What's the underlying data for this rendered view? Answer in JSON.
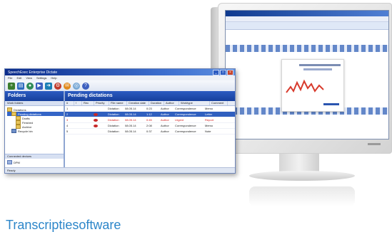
{
  "caption": "Transcriptiesoftware",
  "window": {
    "title": "SpeechExec Enterprise Dictate",
    "menu": [
      "File",
      "Edit",
      "View",
      "Settings",
      "Help"
    ],
    "toolbar": [
      {
        "icon": "new-icon",
        "color": "#3b7d2f"
      },
      {
        "icon": "open-icon",
        "color": "#2d6bbf"
      },
      {
        "icon": "record-icon",
        "color": "#2e8b57"
      },
      {
        "icon": "play-icon",
        "color": "#3a5fbf"
      },
      {
        "icon": "send-icon",
        "color": "#1a7fb5"
      },
      {
        "icon": "settings-icon",
        "color": "#c0392b"
      },
      {
        "icon": "mail-icon",
        "color": "#e08a1e"
      },
      {
        "icon": "network-icon",
        "color": "#7aa9d6"
      },
      {
        "icon": "help-icon",
        "color": "#3d5fbf"
      }
    ]
  },
  "left_pane": {
    "header": "Folders",
    "subheader": "Work folders",
    "tree": [
      {
        "label": "Dictations",
        "level": 1,
        "selected": false
      },
      {
        "label": "Pending dictations",
        "level": 2,
        "selected": true
      },
      {
        "label": "Drafts",
        "level": 3,
        "selected": false
      },
      {
        "label": "Finished",
        "level": 3,
        "selected": false
      },
      {
        "label": "Archive",
        "level": 3,
        "selected": false
      },
      {
        "label": "Recycle bin",
        "level": 2,
        "selected": false
      }
    ],
    "lower_header": "Connected devices",
    "lower_item": "DPM",
    "show_all": "Show all"
  },
  "right_pane": {
    "header": "Pending dictations",
    "columns": [
      "#",
      "!",
      "Rec",
      "Priority",
      "File name",
      "Creation date",
      "Duration",
      "Author",
      "Worktype",
      "Comment"
    ],
    "rows": [
      {
        "style": "normal",
        "cells": [
          "1",
          "",
          "",
          "",
          "Dictation",
          "08.05.14",
          "0:23",
          "Author",
          "Correspondence",
          "Memo"
        ]
      },
      {
        "style": "selected",
        "cells": [
          "2",
          "",
          "",
          "",
          "Dictation",
          "08.05.14",
          "1:12",
          "Author",
          "Correspondence",
          "Letter"
        ]
      },
      {
        "style": "red",
        "cells": [
          "3",
          "",
          "",
          "",
          "Dictation",
          "08.05.14",
          "0:45",
          "Author",
          "Urgent",
          "Report"
        ]
      },
      {
        "style": "normal",
        "cells": [
          "4",
          "",
          "",
          "",
          "Dictation",
          "08.05.14",
          "2:08",
          "Author",
          "Correspondence",
          "Memo"
        ]
      },
      {
        "style": "normal",
        "cells": [
          "5",
          "",
          "",
          "",
          "Dictation",
          "08.05.14",
          "0:37",
          "Author",
          "Correspondence",
          "Note"
        ]
      }
    ]
  },
  "status": "Ready"
}
